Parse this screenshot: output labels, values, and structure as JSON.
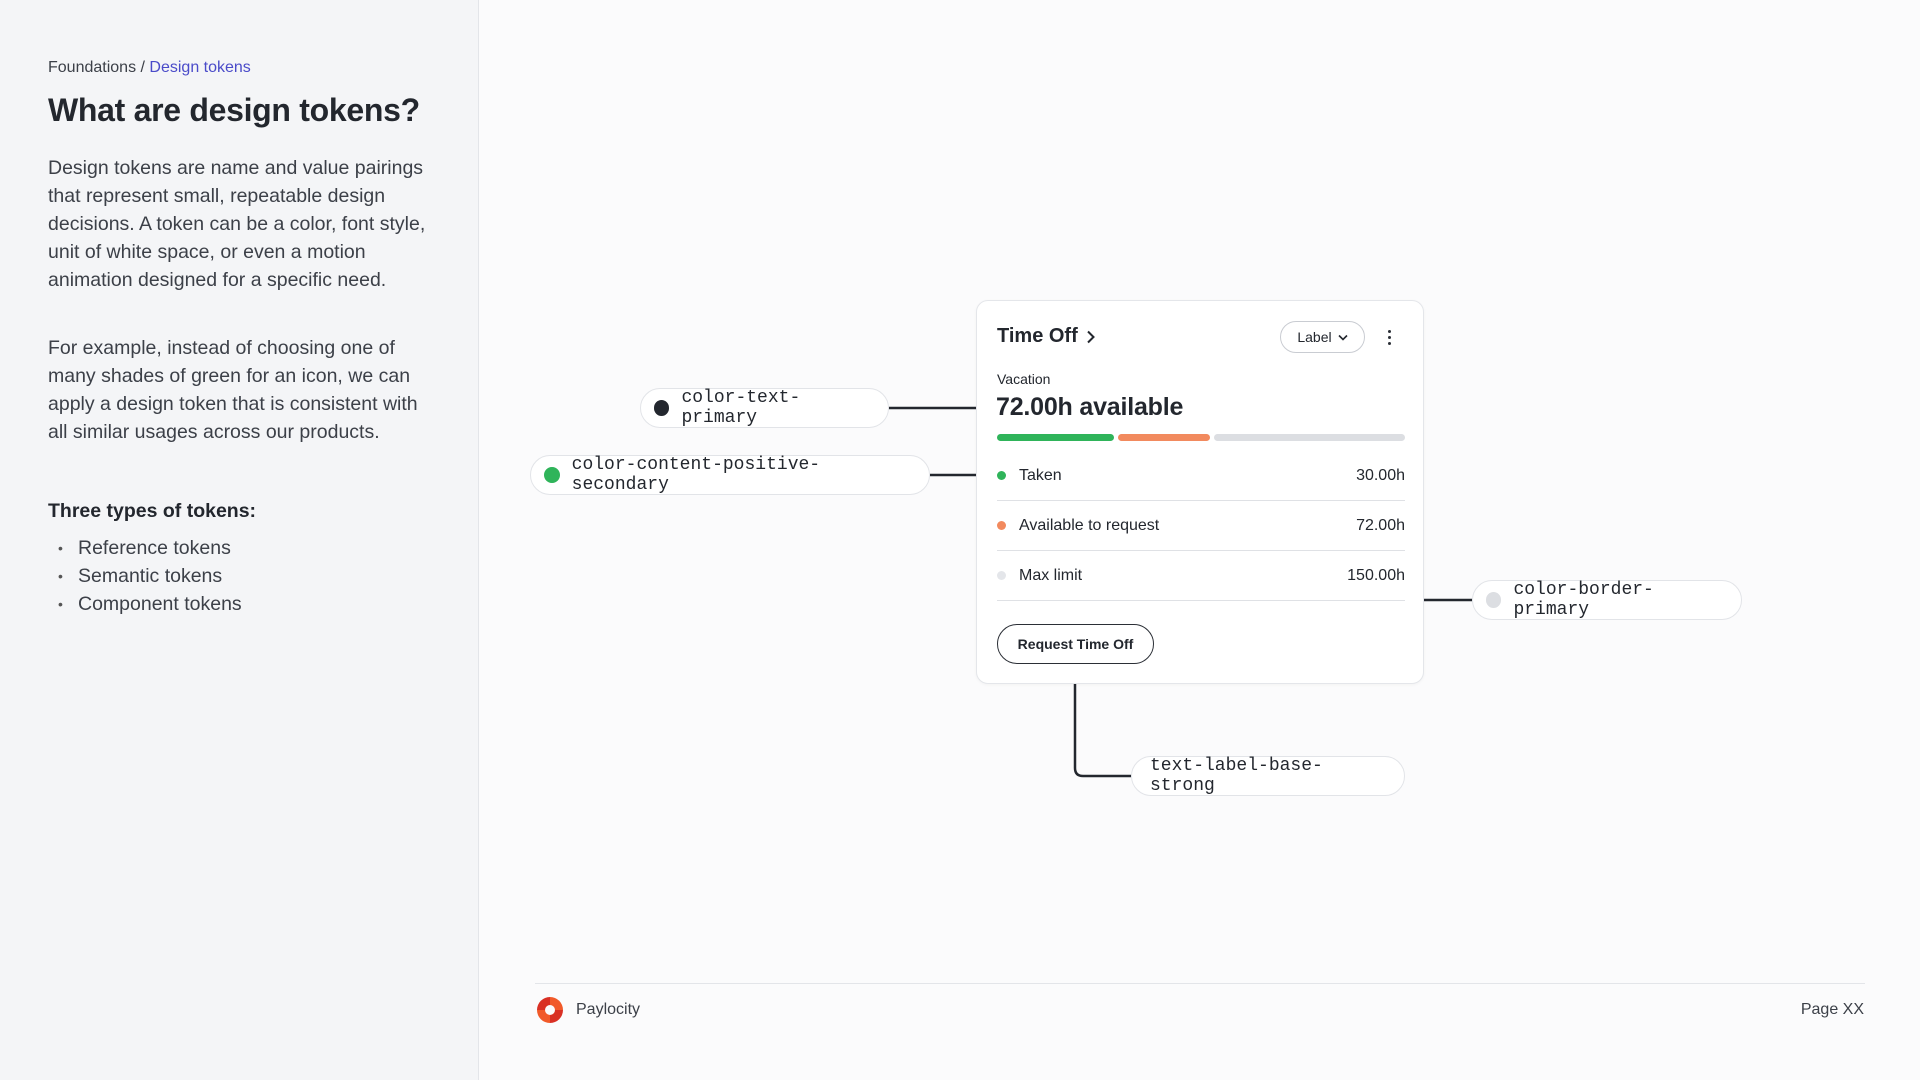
{
  "breadcrumb": {
    "parent": "Foundations",
    "separator": " / ",
    "current": "Design tokens"
  },
  "page_title": "What are design tokens?",
  "intro": {
    "paragraph_1": "Design tokens are name and value pairings that represent small, repeatable design decisions. A token can be a color, font style, unit of white space, or even a motion animation designed for a specific need.",
    "paragraph_2": "For example, instead of choosing one of many shades of green for an icon, we can apply a design token that is consistent with all similar usages across our products."
  },
  "types": {
    "heading": "Three types of tokens:",
    "items": [
      "Reference tokens",
      "Semantic tokens",
      "Component tokens"
    ]
  },
  "card": {
    "title": "Time Off",
    "dropdown_label": "Label",
    "category": "Vacation",
    "available": "72.00h available",
    "progress": {
      "taken_fraction": 0.2,
      "requestable_fraction": 0.48
    },
    "rows": [
      {
        "label": "Taken",
        "value": "30.00h",
        "color": "#2fb45a"
      },
      {
        "label": "Available to request",
        "value": "72.00h",
        "color": "#f28a5e"
      },
      {
        "label": "Max limit",
        "value": "150.00h",
        "color": "#e4e6ea"
      }
    ],
    "button_label": "Request Time Off"
  },
  "tokens": [
    {
      "name": "color-text-primary",
      "swatch": "#23272e"
    },
    {
      "name": "color-content-positive-secondary",
      "swatch": "#2fb45a"
    },
    {
      "name": "color-border-primary",
      "swatch": "#dcdee2"
    },
    {
      "name": "text-label-base-strong"
    }
  ],
  "footer": {
    "brand": "Paylocity",
    "page": "Page XX"
  },
  "colors": {
    "accent": "#4a4bc9",
    "connector": "#23272e",
    "logo_orange": "#f15a29",
    "logo_red": "#d93025"
  }
}
